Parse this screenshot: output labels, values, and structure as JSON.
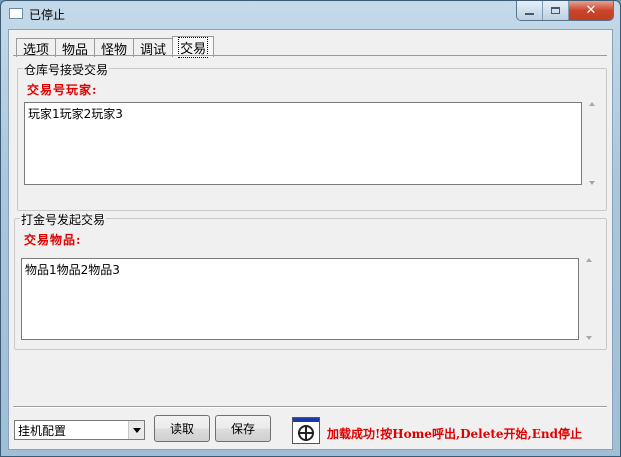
{
  "window": {
    "title": "已停止",
    "controls": {
      "minimize_icon": "minimize-icon",
      "maximize_icon": "maximize-icon",
      "close_icon": "close-icon",
      "close_glyph": "✕"
    }
  },
  "tabs": [
    {
      "label": "选项",
      "active": false
    },
    {
      "label": "物品",
      "active": false
    },
    {
      "label": "怪物",
      "active": false
    },
    {
      "label": "调试",
      "active": false
    },
    {
      "label": "交易",
      "active": true
    }
  ],
  "group_receive": {
    "legend": "仓库号接受交易",
    "field_label": "交易号玩家:",
    "value": "玩家1玩家2玩家3"
  },
  "group_send": {
    "legend": "打金号发起交易",
    "field_label": "交易物品:",
    "value": "物品1物品2物品3"
  },
  "footer": {
    "config_select": {
      "selected": "挂机配置"
    },
    "read_button": "读取",
    "save_button": "保存",
    "status_icon": "crosshair-icon",
    "status_message": "加载成功!按Home呼出,Delete开始,End停止"
  },
  "colors": {
    "status_red": "#e00000",
    "title_bar": "#a9c6dc",
    "close_button": "#c9462c"
  }
}
